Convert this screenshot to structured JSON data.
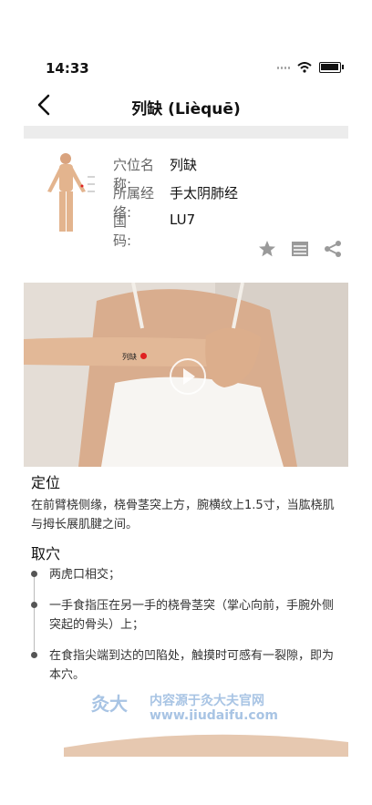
{
  "status": {
    "time": "14:33"
  },
  "header": {
    "title": "列缺 (Lièquē)"
  },
  "info": {
    "name_label": "穴位名称:",
    "name_value": "列缺",
    "meridian_label": "所属经络:",
    "meridian_value": "手太阴肺经",
    "code_label": "国　　码:",
    "code_value": "LU7"
  },
  "video": {
    "point_label": "列缺"
  },
  "section1": {
    "heading": "定位",
    "text": "在前臂桡侧缘，桡骨茎突上方，腕横纹上1.5寸，当肱桡肌与拇长展肌腱之间。"
  },
  "section2": {
    "heading": "取穴",
    "steps": [
      "两虎口相交；",
      "一手食指压在另一手的桡骨茎突（掌心向前，手腕外侧突起的骨头）上；",
      "在食指尖端到达的凹陷处，触摸时可感有一裂隙，即为本穴。"
    ]
  },
  "watermark": {
    "logo": "灸大夫",
    "line1": "内容源于灸大夫官网",
    "line2": "www.jiudaifu.com"
  },
  "icons": {
    "back": "chevron-left-icon",
    "star": "star-icon",
    "list": "list-icon",
    "share": "share-icon"
  }
}
